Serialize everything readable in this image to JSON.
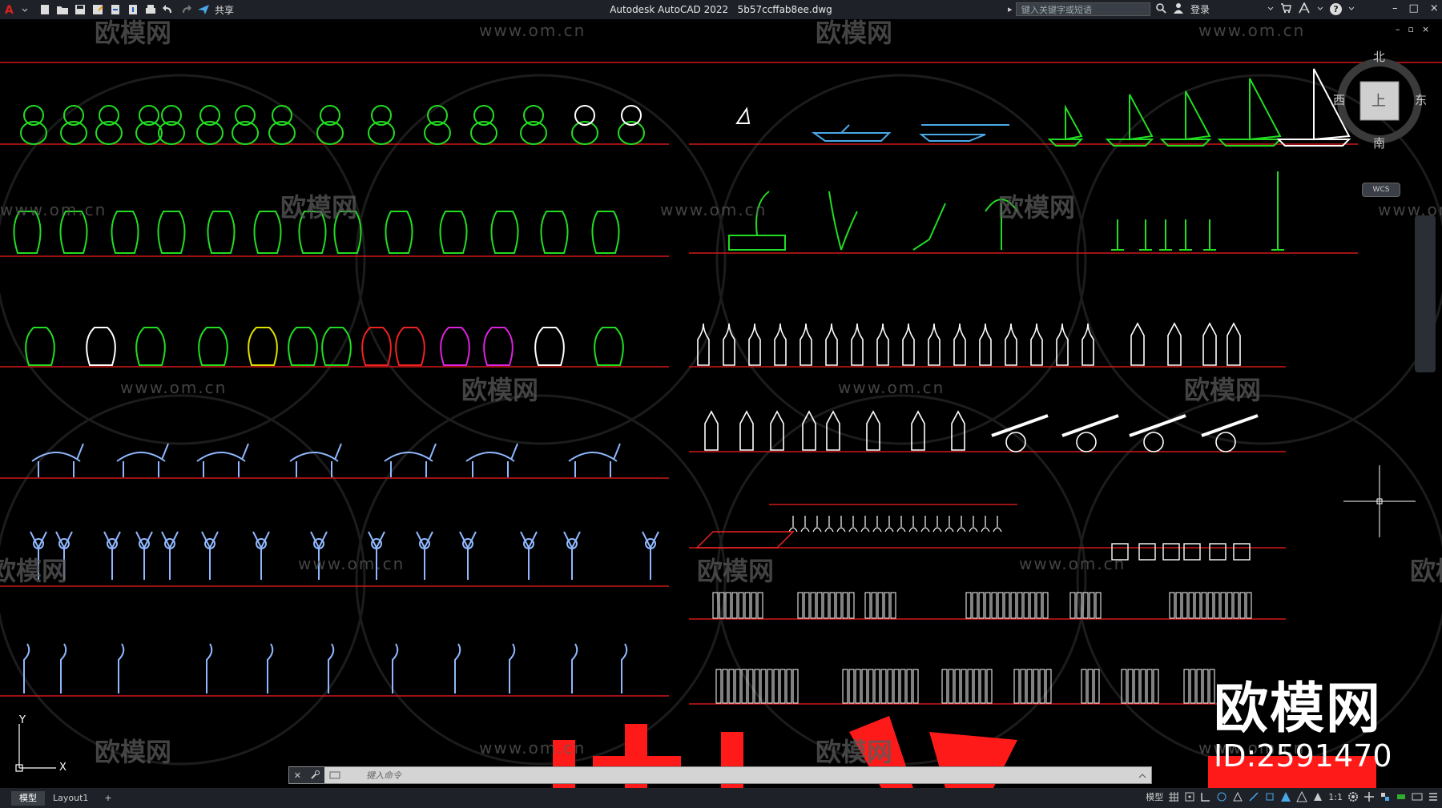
{
  "app": {
    "title": "Autodesk AutoCAD 2022",
    "filename": "5b57ccffab8ee.dwg",
    "share_label": "共享",
    "search_placeholder": "键入关键字或短语",
    "login_label": "登录",
    "help_icon": "?"
  },
  "window_controls": [
    "–",
    "□",
    "×"
  ],
  "inner_controls": [
    "–",
    "▫",
    "×"
  ],
  "viewcube": {
    "north": "北",
    "south": "南",
    "east": "东",
    "west": "西",
    "face": "上",
    "wcs_label": "WCS"
  },
  "ucs": {
    "x_label": "X",
    "y_label": "Y"
  },
  "command_line": {
    "placeholder": "键入命令"
  },
  "layout_tabs": [
    {
      "label": "模型",
      "active": true
    },
    {
      "label": "Layout1",
      "active": false
    },
    {
      "label": "+",
      "active": false
    }
  ],
  "status_bar": {
    "model_label": "模型",
    "scale_label": "1:1"
  },
  "watermarks": {
    "url": "www.om.cn",
    "cn": "欧模网"
  },
  "brand_overlay": {
    "name": "欧模网",
    "id_text": "ID:2591470"
  },
  "colors": {
    "canvas_bg": "#000000",
    "shelf_line": "#d01818",
    "green_entities": "#22dd22",
    "cyan_entities": "#4aa8e8",
    "blue_entities": "#8fb8ff",
    "magenta_entities": "#dd22dd",
    "red_entities": "#ee2222",
    "yellow_entities": "#e0e000",
    "bottom_red_text": "#ff1a1a"
  }
}
